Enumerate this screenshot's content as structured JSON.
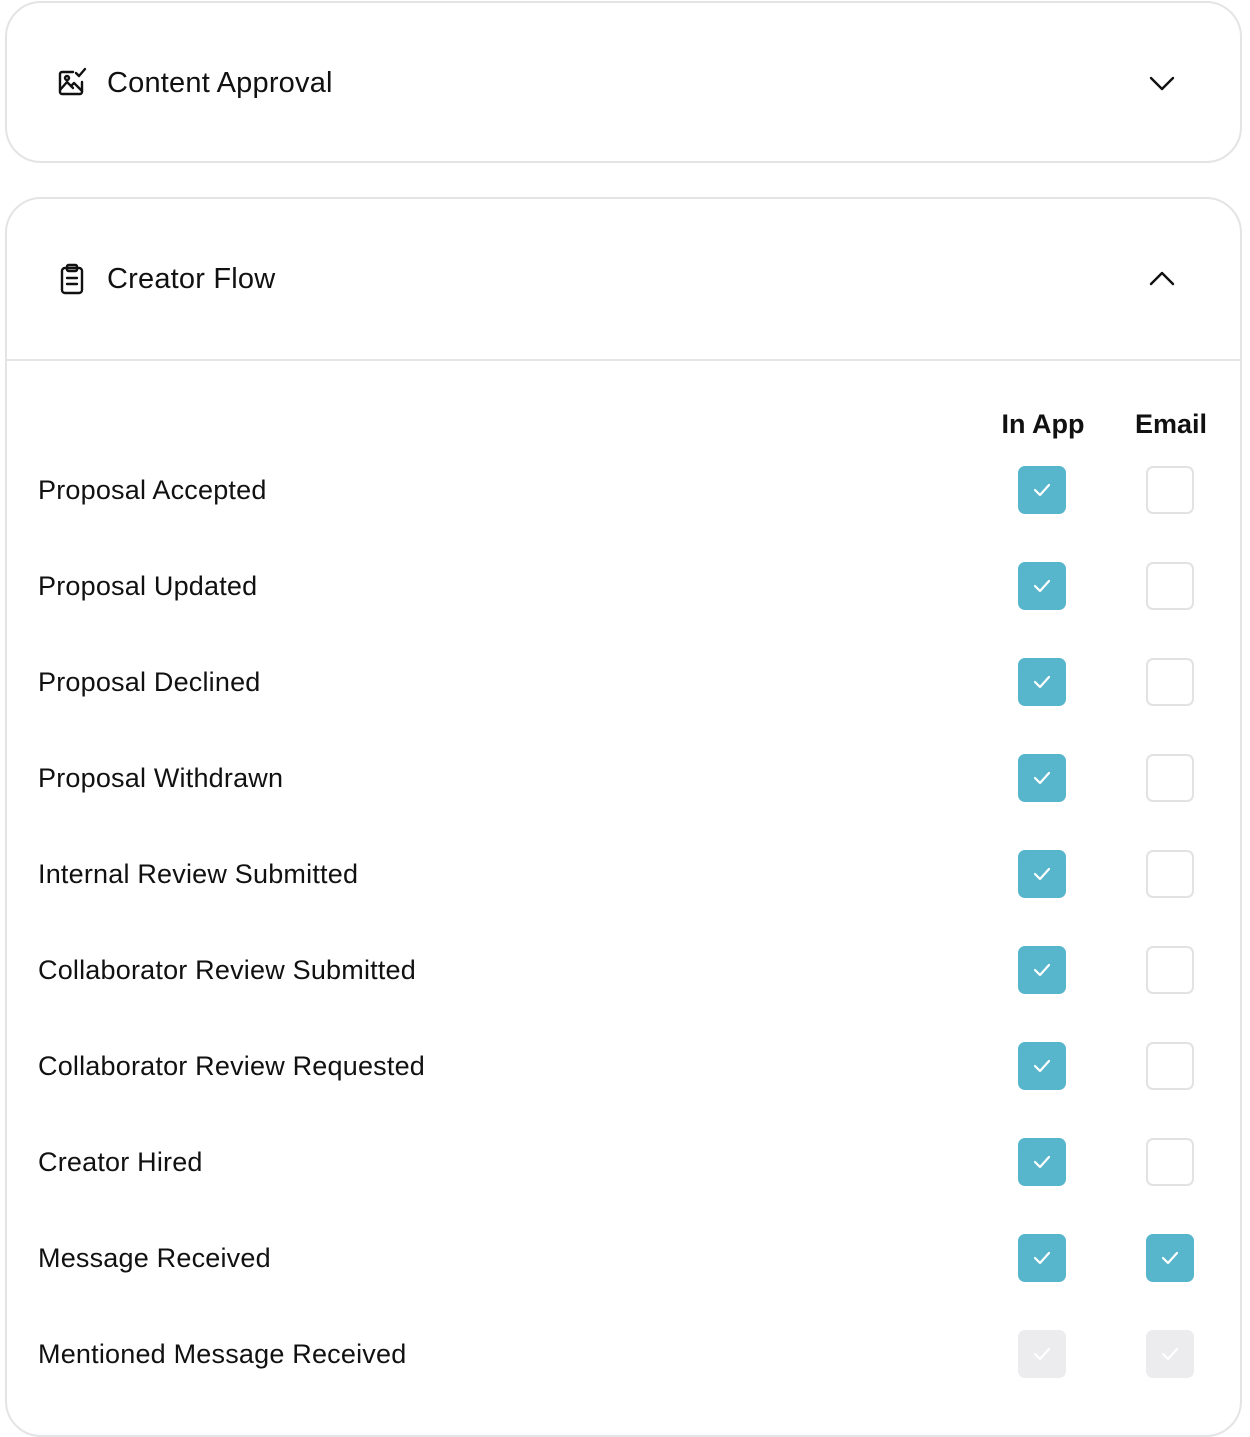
{
  "sections": [
    {
      "title": "Content Approval",
      "icon": "image-check-icon",
      "expanded": false
    },
    {
      "title": "Creator Flow",
      "icon": "clipboard-icon",
      "expanded": true
    }
  ],
  "columns": {
    "in_app": "In App",
    "email": "Email"
  },
  "colors": {
    "checked": "#58b6cc",
    "unchecked_border": "#e2e2e5",
    "disabled": "#ececee",
    "card_border": "#e4e4e7"
  },
  "rows": [
    {
      "label": "Proposal Accepted",
      "in_app": "checked",
      "email": "unchecked"
    },
    {
      "label": "Proposal Updated",
      "in_app": "checked",
      "email": "unchecked"
    },
    {
      "label": "Proposal Declined",
      "in_app": "checked",
      "email": "unchecked"
    },
    {
      "label": "Proposal Withdrawn",
      "in_app": "checked",
      "email": "unchecked"
    },
    {
      "label": "Internal Review Submitted",
      "in_app": "checked",
      "email": "unchecked"
    },
    {
      "label": "Collaborator Review Submitted",
      "in_app": "checked",
      "email": "unchecked"
    },
    {
      "label": "Collaborator Review Requested",
      "in_app": "checked",
      "email": "unchecked"
    },
    {
      "label": "Creator Hired",
      "in_app": "checked",
      "email": "unchecked"
    },
    {
      "label": "Message Received",
      "in_app": "checked",
      "email": "checked"
    },
    {
      "label": "Mentioned Message Received",
      "in_app": "disabled",
      "email": "disabled"
    }
  ]
}
